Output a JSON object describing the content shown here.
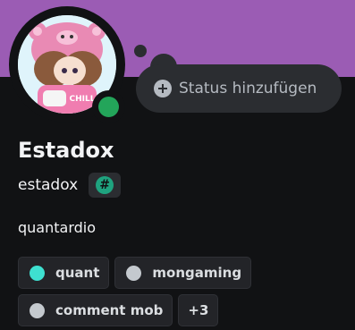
{
  "profile": {
    "display_name": "Estadox",
    "username": "estadox",
    "bio": "quantardio",
    "status_prompt": "Status hinzufügen",
    "badge_symbol": "#",
    "online_color": "#23a55a",
    "banner_color": "#9b5cb4",
    "avatar_text": "CHILL GIRL"
  },
  "roles": [
    {
      "name": "quant",
      "color": "#3ee0d0"
    },
    {
      "name": "mongaming",
      "color": "#c4c9ce"
    },
    {
      "name": "comment mob",
      "color": "#c4c9ce"
    }
  ],
  "roles_more": "+3"
}
